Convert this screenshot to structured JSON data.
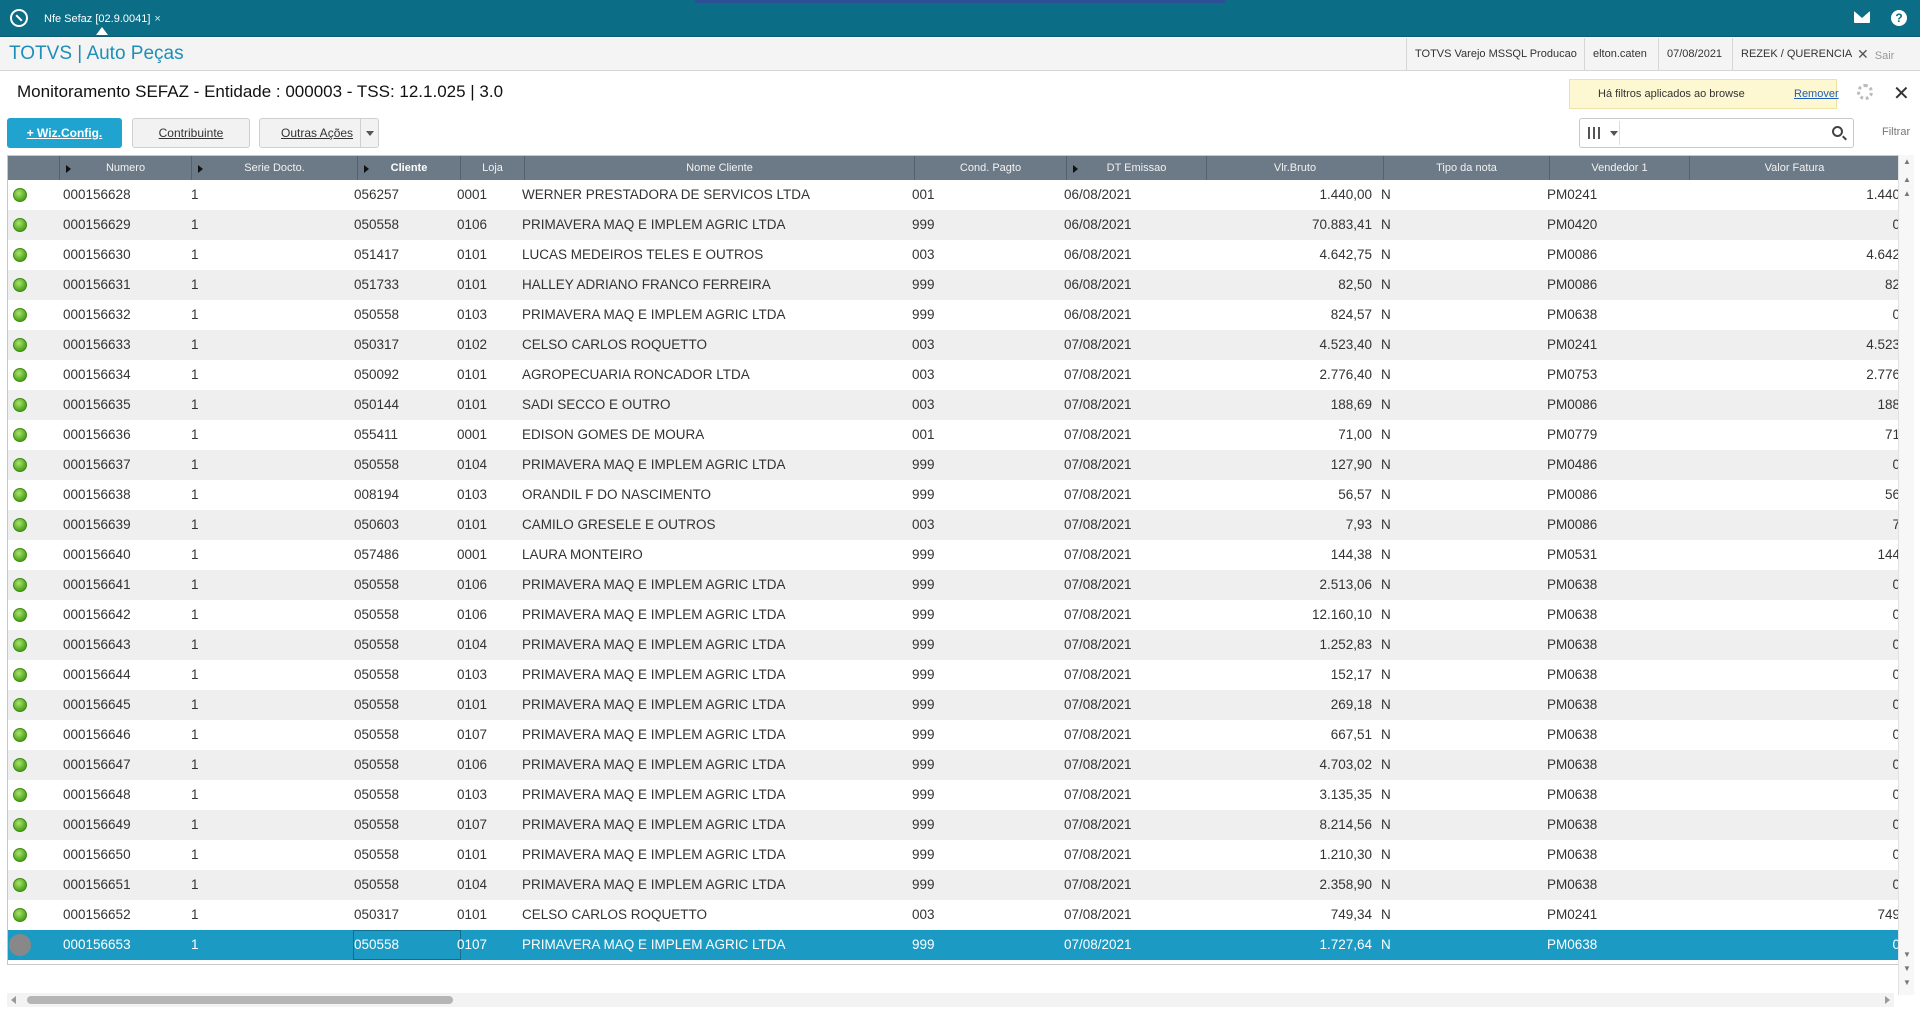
{
  "tab": {
    "label": "Nfe Sefaz [02.9.0041]",
    "close": "×"
  },
  "app": {
    "brand": "TOTVS | Auto Peças",
    "environment": "TOTVS Varejo MSSQL Producao",
    "user": "elton.caten",
    "date": "07/08/2021",
    "company": "REZEK / QUERENCIA",
    "exit": "Sair"
  },
  "page": {
    "title": "Monitoramento SEFAZ - Entidade : 000003 - TSS: 12.1.025 | 3.0",
    "filter_note": "Há filtros aplicados ao browse",
    "filter_remove": "Remover",
    "filtrar": "Filtrar",
    "search_placeholder": ""
  },
  "toolbar": {
    "wiz": "+ Wiz.Config.",
    "contribuinte": "Contribuinte",
    "outras": "Outras Ações"
  },
  "icons": {
    "logo": "totvs-logo-icon",
    "mail": "mail-icon",
    "help": "help-icon",
    "gear": "gear-icon",
    "close": "close-icon",
    "search": "search-icon",
    "columns": "columns-icon"
  },
  "colors": {
    "accent": "#21a3cf",
    "selected_row": "#1b9bc3",
    "status_ok": "#5cb82a",
    "header_bg": "#6b7a86"
  },
  "grid": {
    "columns": [
      "Numero",
      "Serie Docto.",
      "Cliente",
      "Loja",
      "Nome Cliente",
      "Cond. Pagto",
      "DT Emissao",
      "Vlr.Bruto",
      "Tipo da nota",
      "Vendedor 1",
      "Valor Fatura"
    ],
    "rows": [
      [
        "000156628",
        "1",
        "056257",
        "0001",
        "WERNER PRESTADORA DE SERVICOS LTDA",
        "001",
        "06/08/2021",
        "1.440,00",
        "N",
        "PM0241",
        "1.440"
      ],
      [
        "000156629",
        "1",
        "050558",
        "0106",
        "PRIMAVERA MAQ E IMPLEM AGRIC LTDA",
        "999",
        "06/08/2021",
        "70.883,41",
        "N",
        "PM0420",
        "0"
      ],
      [
        "000156630",
        "1",
        "051417",
        "0101",
        "LUCAS MEDEIROS TELES E OUTROS",
        "003",
        "06/08/2021",
        "4.642,75",
        "N",
        "PM0086",
        "4.642"
      ],
      [
        "000156631",
        "1",
        "051733",
        "0101",
        "HALLEY ADRIANO FRANCO FERREIRA",
        "999",
        "06/08/2021",
        "82,50",
        "N",
        "PM0086",
        "82"
      ],
      [
        "000156632",
        "1",
        "050558",
        "0103",
        "PRIMAVERA MAQ E IMPLEM AGRIC LTDA",
        "999",
        "06/08/2021",
        "824,57",
        "N",
        "PM0638",
        "0"
      ],
      [
        "000156633",
        "1",
        "050317",
        "0102",
        "CELSO CARLOS ROQUETTO",
        "003",
        "07/08/2021",
        "4.523,40",
        "N",
        "PM0241",
        "4.523"
      ],
      [
        "000156634",
        "1",
        "050092",
        "0101",
        "AGROPECUARIA RONCADOR LTDA",
        "003",
        "07/08/2021",
        "2.776,40",
        "N",
        "PM0753",
        "2.776"
      ],
      [
        "000156635",
        "1",
        "050144",
        "0101",
        "SADI SECCO E OUTRO",
        "003",
        "07/08/2021",
        "188,69",
        "N",
        "PM0086",
        "188"
      ],
      [
        "000156636",
        "1",
        "055411",
        "0001",
        "EDISON GOMES DE MOURA",
        "001",
        "07/08/2021",
        "71,00",
        "N",
        "PM0779",
        "71"
      ],
      [
        "000156637",
        "1",
        "050558",
        "0104",
        "PRIMAVERA MAQ E IMPLEM AGRIC LTDA",
        "999",
        "07/08/2021",
        "127,90",
        "N",
        "PM0486",
        "0"
      ],
      [
        "000156638",
        "1",
        "008194",
        "0103",
        "ORANDIL F DO NASCIMENTO",
        "999",
        "07/08/2021",
        "56,57",
        "N",
        "PM0086",
        "56"
      ],
      [
        "000156639",
        "1",
        "050603",
        "0101",
        "CAMILO GRESELE E OUTROS",
        "003",
        "07/08/2021",
        "7,93",
        "N",
        "PM0086",
        "7"
      ],
      [
        "000156640",
        "1",
        "057486",
        "0001",
        "LAURA MONTEIRO",
        "999",
        "07/08/2021",
        "144,38",
        "N",
        "PM0531",
        "144"
      ],
      [
        "000156641",
        "1",
        "050558",
        "0106",
        "PRIMAVERA MAQ E IMPLEM AGRIC LTDA",
        "999",
        "07/08/2021",
        "2.513,06",
        "N",
        "PM0638",
        "0"
      ],
      [
        "000156642",
        "1",
        "050558",
        "0106",
        "PRIMAVERA MAQ E IMPLEM AGRIC LTDA",
        "999",
        "07/08/2021",
        "12.160,10",
        "N",
        "PM0638",
        "0"
      ],
      [
        "000156643",
        "1",
        "050558",
        "0104",
        "PRIMAVERA MAQ E IMPLEM AGRIC LTDA",
        "999",
        "07/08/2021",
        "1.252,83",
        "N",
        "PM0638",
        "0"
      ],
      [
        "000156644",
        "1",
        "050558",
        "0103",
        "PRIMAVERA MAQ E IMPLEM AGRIC LTDA",
        "999",
        "07/08/2021",
        "152,17",
        "N",
        "PM0638",
        "0"
      ],
      [
        "000156645",
        "1",
        "050558",
        "0101",
        "PRIMAVERA MAQ E IMPLEM AGRIC LTDA",
        "999",
        "07/08/2021",
        "269,18",
        "N",
        "PM0638",
        "0"
      ],
      [
        "000156646",
        "1",
        "050558",
        "0107",
        "PRIMAVERA MAQ E IMPLEM AGRIC LTDA",
        "999",
        "07/08/2021",
        "667,51",
        "N",
        "PM0638",
        "0"
      ],
      [
        "000156647",
        "1",
        "050558",
        "0106",
        "PRIMAVERA MAQ E IMPLEM AGRIC LTDA",
        "999",
        "07/08/2021",
        "4.703,02",
        "N",
        "PM0638",
        "0"
      ],
      [
        "000156648",
        "1",
        "050558",
        "0103",
        "PRIMAVERA MAQ E IMPLEM AGRIC LTDA",
        "999",
        "07/08/2021",
        "3.135,35",
        "N",
        "PM0638",
        "0"
      ],
      [
        "000156649",
        "1",
        "050558",
        "0107",
        "PRIMAVERA MAQ E IMPLEM AGRIC LTDA",
        "999",
        "07/08/2021",
        "8.214,56",
        "N",
        "PM0638",
        "0"
      ],
      [
        "000156650",
        "1",
        "050558",
        "0101",
        "PRIMAVERA MAQ E IMPLEM AGRIC LTDA",
        "999",
        "07/08/2021",
        "1.210,30",
        "N",
        "PM0638",
        "0"
      ],
      [
        "000156651",
        "1",
        "050558",
        "0104",
        "PRIMAVERA MAQ E IMPLEM AGRIC LTDA",
        "999",
        "07/08/2021",
        "2.358,90",
        "N",
        "PM0638",
        "0"
      ],
      [
        "000156652",
        "1",
        "050317",
        "0101",
        "CELSO CARLOS ROQUETTO",
        "003",
        "07/08/2021",
        "749,34",
        "N",
        "PM0241",
        "749"
      ],
      [
        "000156653",
        "1",
        "050558",
        "0107",
        "PRIMAVERA MAQ E IMPLEM AGRIC LTDA",
        "999",
        "07/08/2021",
        "1.727,64",
        "N",
        "PM0638",
        "0"
      ]
    ],
    "selected_index": 25
  }
}
